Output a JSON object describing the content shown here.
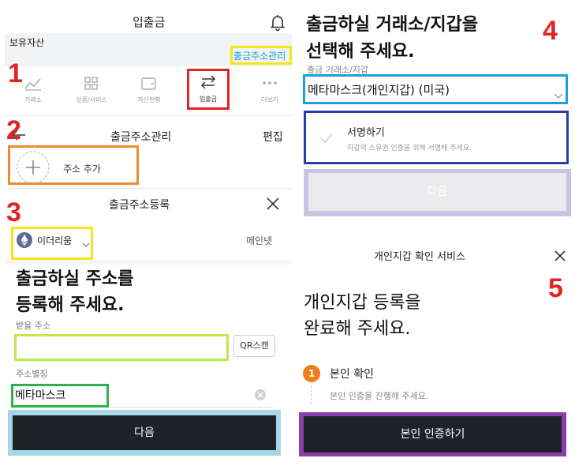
{
  "header": {
    "title": "입출금",
    "bell_icon": "bell-icon"
  },
  "holdings": {
    "label": "보유자산",
    "manage_link": "출금주소관리"
  },
  "nav": [
    {
      "label": "거래소",
      "icon": "chart-icon"
    },
    {
      "label": "상품/서비스",
      "icon": "grid-icon"
    },
    {
      "label": "자산현황",
      "icon": "wallet-icon"
    },
    {
      "label": "입출금",
      "icon": "transfer-icon"
    },
    {
      "label": "더보기",
      "icon": "more-icon"
    }
  ],
  "address_manage": {
    "title": "출금주소관리",
    "edit": "편집",
    "add": "주소 추가"
  },
  "address_register": {
    "title": "출금주소등록",
    "coin": "이더리움",
    "network": "메인넷",
    "headline1": "출금하실 주소를",
    "headline2": "등록해 주세요.",
    "recv_label": "받을 주소",
    "recv_value": "",
    "qr_button": "QR스캔",
    "alias_label": "주소별칭",
    "alias_value": "메타마스크",
    "next": "다음"
  },
  "select_wallet": {
    "headline1": "출금하실 거래소/지갑을",
    "headline2": "선택해 주세요.",
    "field_label": "출금 거래소/지갑",
    "field_value": "메타마스크(개인지갑) (미국)",
    "sign_title": "서명하기",
    "sign_desc": "지갑의 소유권 인증을 위해 서명해 주세요.",
    "next": "다음"
  },
  "personal_wallet": {
    "title": "개인지갑 확인 서비스",
    "headline1": "개인지갑 등록을",
    "headline2": "완료해 주세요.",
    "step_num": "1",
    "step_title": "본인 확인",
    "step_desc": "본인 인증을 진행해 주세요.",
    "button": "본인 인증하기"
  },
  "markers": [
    "1",
    "2",
    "3",
    "4",
    "5"
  ],
  "colors": {
    "marker": "#e02424",
    "yellow": "#f5e51b",
    "red_box": "#e02424",
    "orange": "#f08a2c",
    "lime": "#bfe84a",
    "green": "#2eb04a",
    "lightblue": "#a6d6e8",
    "blue": "#1aa0dc",
    "navy": "#2a3ca8",
    "lavender": "#c9c3e4",
    "purple": "#8a3fa8",
    "dark_button": "#1f2228",
    "step_orange": "#f07d1a"
  }
}
